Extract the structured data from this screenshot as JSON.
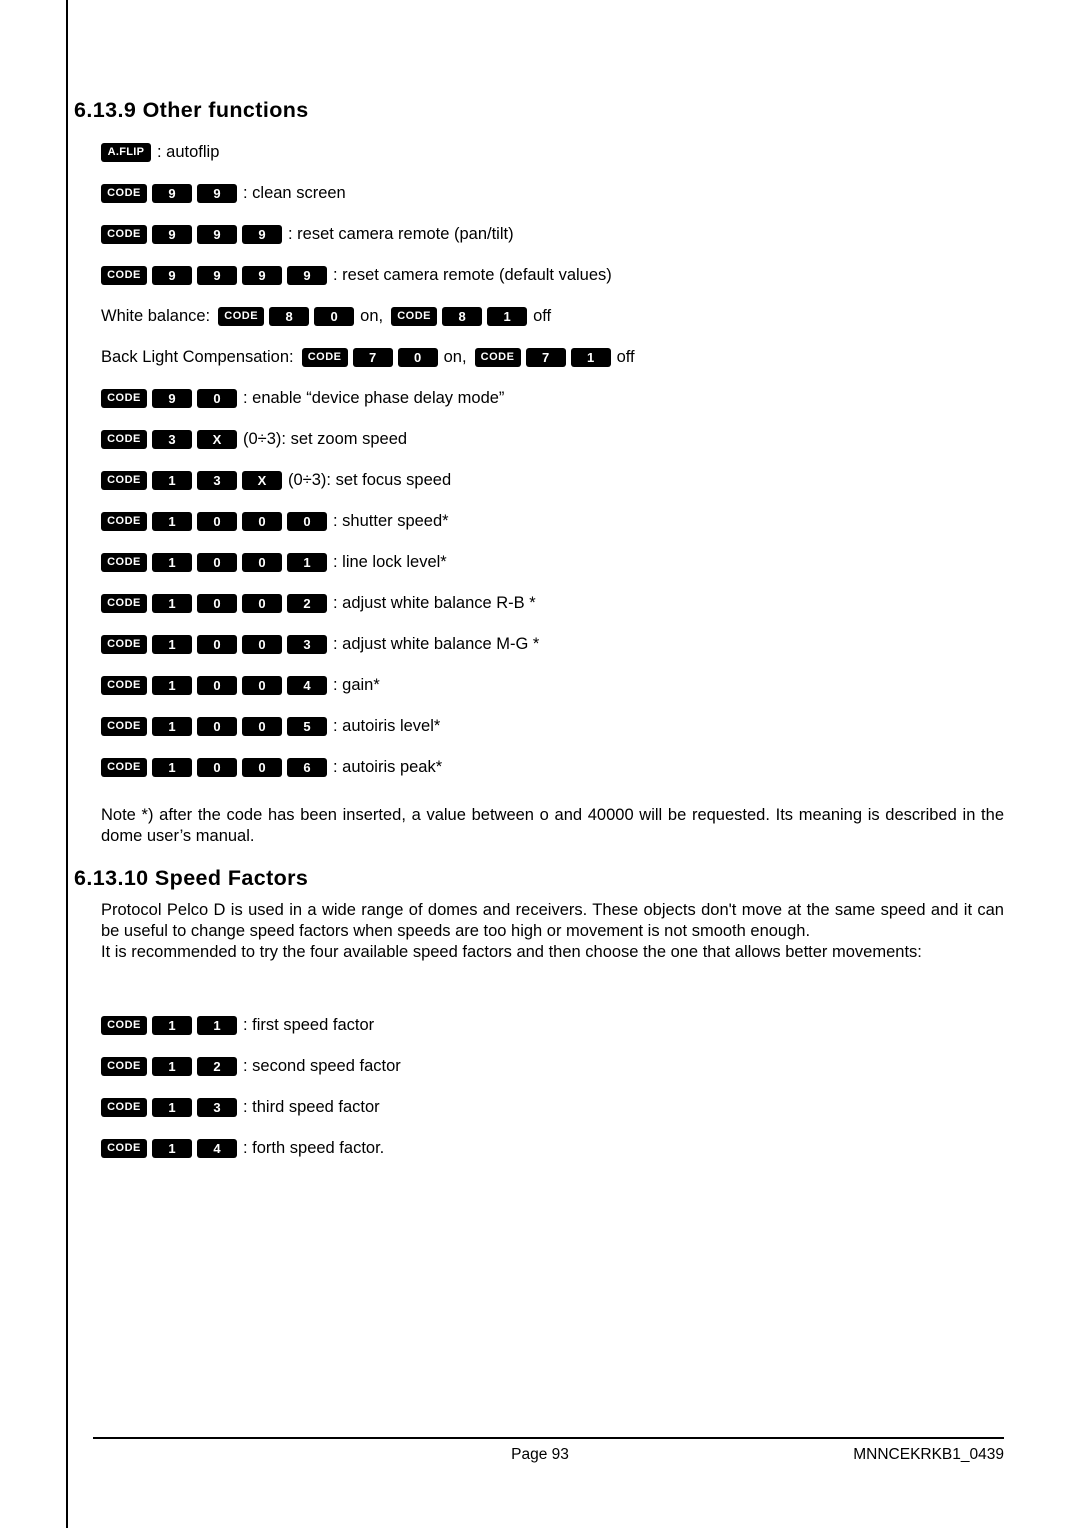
{
  "sections": {
    "other_functions": {
      "number": "6.13.9",
      "title": "Other functions"
    },
    "speed_factors": {
      "number": "6.13.10",
      "title": "Speed Factors"
    }
  },
  "keys": {
    "code": "CODE",
    "aflip": "A.FLIP"
  },
  "other_function_lines": [
    {
      "keys": [
        "A.FLIP"
      ],
      "text": ": autoflip"
    },
    {
      "keys": [
        "CODE",
        "9",
        "9"
      ],
      "text": ": clean screen"
    },
    {
      "keys": [
        "CODE",
        "9",
        "9",
        "9"
      ],
      "text": ": reset camera remote (pan/tilt)"
    },
    {
      "keys": [
        "CODE",
        "9",
        "9",
        "9",
        "9"
      ],
      "text": ": reset camera remote (default values)"
    },
    {
      "keys": [
        "CODE",
        "9",
        "0"
      ],
      "text": ": enable “device phase delay mode”"
    },
    {
      "keys": [
        "CODE",
        "3",
        "X"
      ],
      "text": "(0÷3): set zoom speed"
    },
    {
      "keys": [
        "CODE",
        "1",
        "3",
        "X"
      ],
      "text": "(0÷3): set focus speed"
    },
    {
      "keys": [
        "CODE",
        "1",
        "0",
        "0",
        "0"
      ],
      "text": ": shutter speed*"
    },
    {
      "keys": [
        "CODE",
        "1",
        "0",
        "0",
        "1"
      ],
      "text": ": line lock level*"
    },
    {
      "keys": [
        "CODE",
        "1",
        "0",
        "0",
        "2"
      ],
      "text": ": adjust white balance R-B *"
    },
    {
      "keys": [
        "CODE",
        "1",
        "0",
        "0",
        "3"
      ],
      "text": ": adjust white balance M-G *"
    },
    {
      "keys": [
        "CODE",
        "1",
        "0",
        "0",
        "4"
      ],
      "text": ": gain*"
    },
    {
      "keys": [
        "CODE",
        "1",
        "0",
        "0",
        "5"
      ],
      "text": ": autoiris level*"
    },
    {
      "keys": [
        "CODE",
        "1",
        "0",
        "0",
        "6"
      ],
      "text": ": autoiris peak*"
    }
  ],
  "white_balance": {
    "label": "White balance:",
    "on_keys": [
      "CODE",
      "8",
      "0"
    ],
    "on_text": "on,",
    "off_keys": [
      "CODE",
      "8",
      "1"
    ],
    "off_text": "off"
  },
  "back_light": {
    "label": "Back Light Compensation:",
    "on_keys": [
      "CODE",
      "7",
      "0"
    ],
    "on_text": "on,",
    "off_keys": [
      "CODE",
      "7",
      "1"
    ],
    "off_text": "off"
  },
  "note": "Note *) after the code has been inserted, a value between o and 40000 will be requested. Its meaning is described in the dome user’s manual.",
  "speed_factors_paragraph": "Protocol Pelco D is used in a wide range of domes and receivers. These objects don't move at the same speed and it can be useful to change speed factors when speeds are too high or movement is not smooth enough.\nIt is recommended to try the four available speed factors and then choose the one that allows better movements:",
  "speed_factor_lines": [
    {
      "keys": [
        "CODE",
        "1",
        "1"
      ],
      "text": ": first speed factor"
    },
    {
      "keys": [
        "CODE",
        "1",
        "2"
      ],
      "text": ": second speed factor"
    },
    {
      "keys": [
        "CODE",
        "1",
        "3"
      ],
      "text": ": third speed factor"
    },
    {
      "keys": [
        "CODE",
        "1",
        "4"
      ],
      "text": ": forth speed factor."
    }
  ],
  "footer": {
    "page": "Page 93",
    "doc_code": "MNNCEKRKB1_0439"
  }
}
